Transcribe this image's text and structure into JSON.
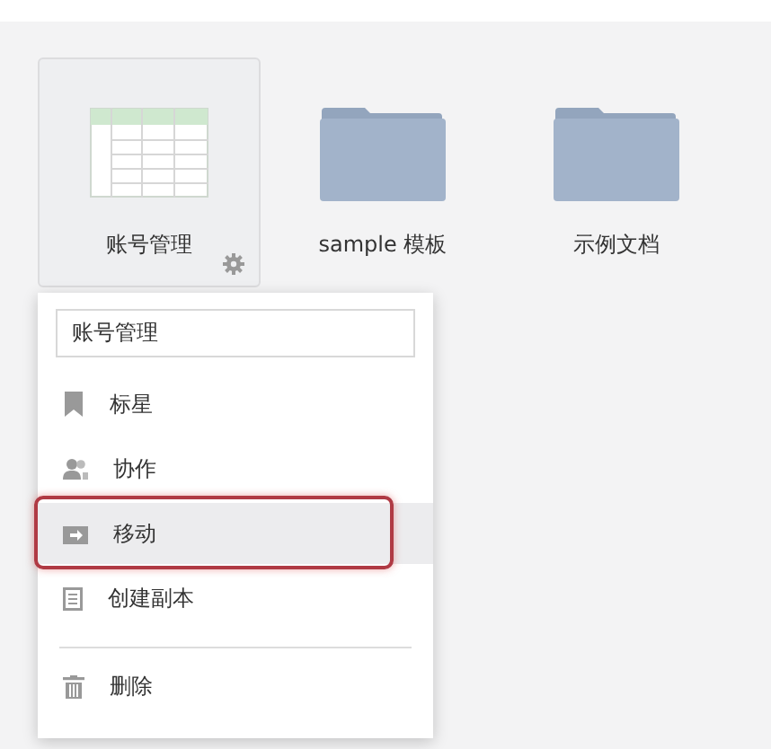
{
  "files": [
    {
      "kind": "sheet",
      "name": "账号管理",
      "selected": true
    },
    {
      "kind": "folder",
      "name": "sample 模板",
      "selected": false
    },
    {
      "kind": "folder",
      "name": "示例文档",
      "selected": false
    }
  ],
  "menu": {
    "rename_value": "账号管理",
    "items": [
      {
        "kind": "star",
        "label": "标星",
        "hovered": false,
        "annotated": false
      },
      {
        "kind": "share",
        "label": "协作",
        "hovered": false,
        "annotated": false
      },
      {
        "kind": "move",
        "label": "移动",
        "hovered": true,
        "annotated": true
      },
      {
        "kind": "copy",
        "label": "创建副本",
        "hovered": false,
        "annotated": false
      },
      {
        "kind": "divider"
      },
      {
        "kind": "delete",
        "label": "删除",
        "hovered": false,
        "annotated": false
      }
    ]
  }
}
